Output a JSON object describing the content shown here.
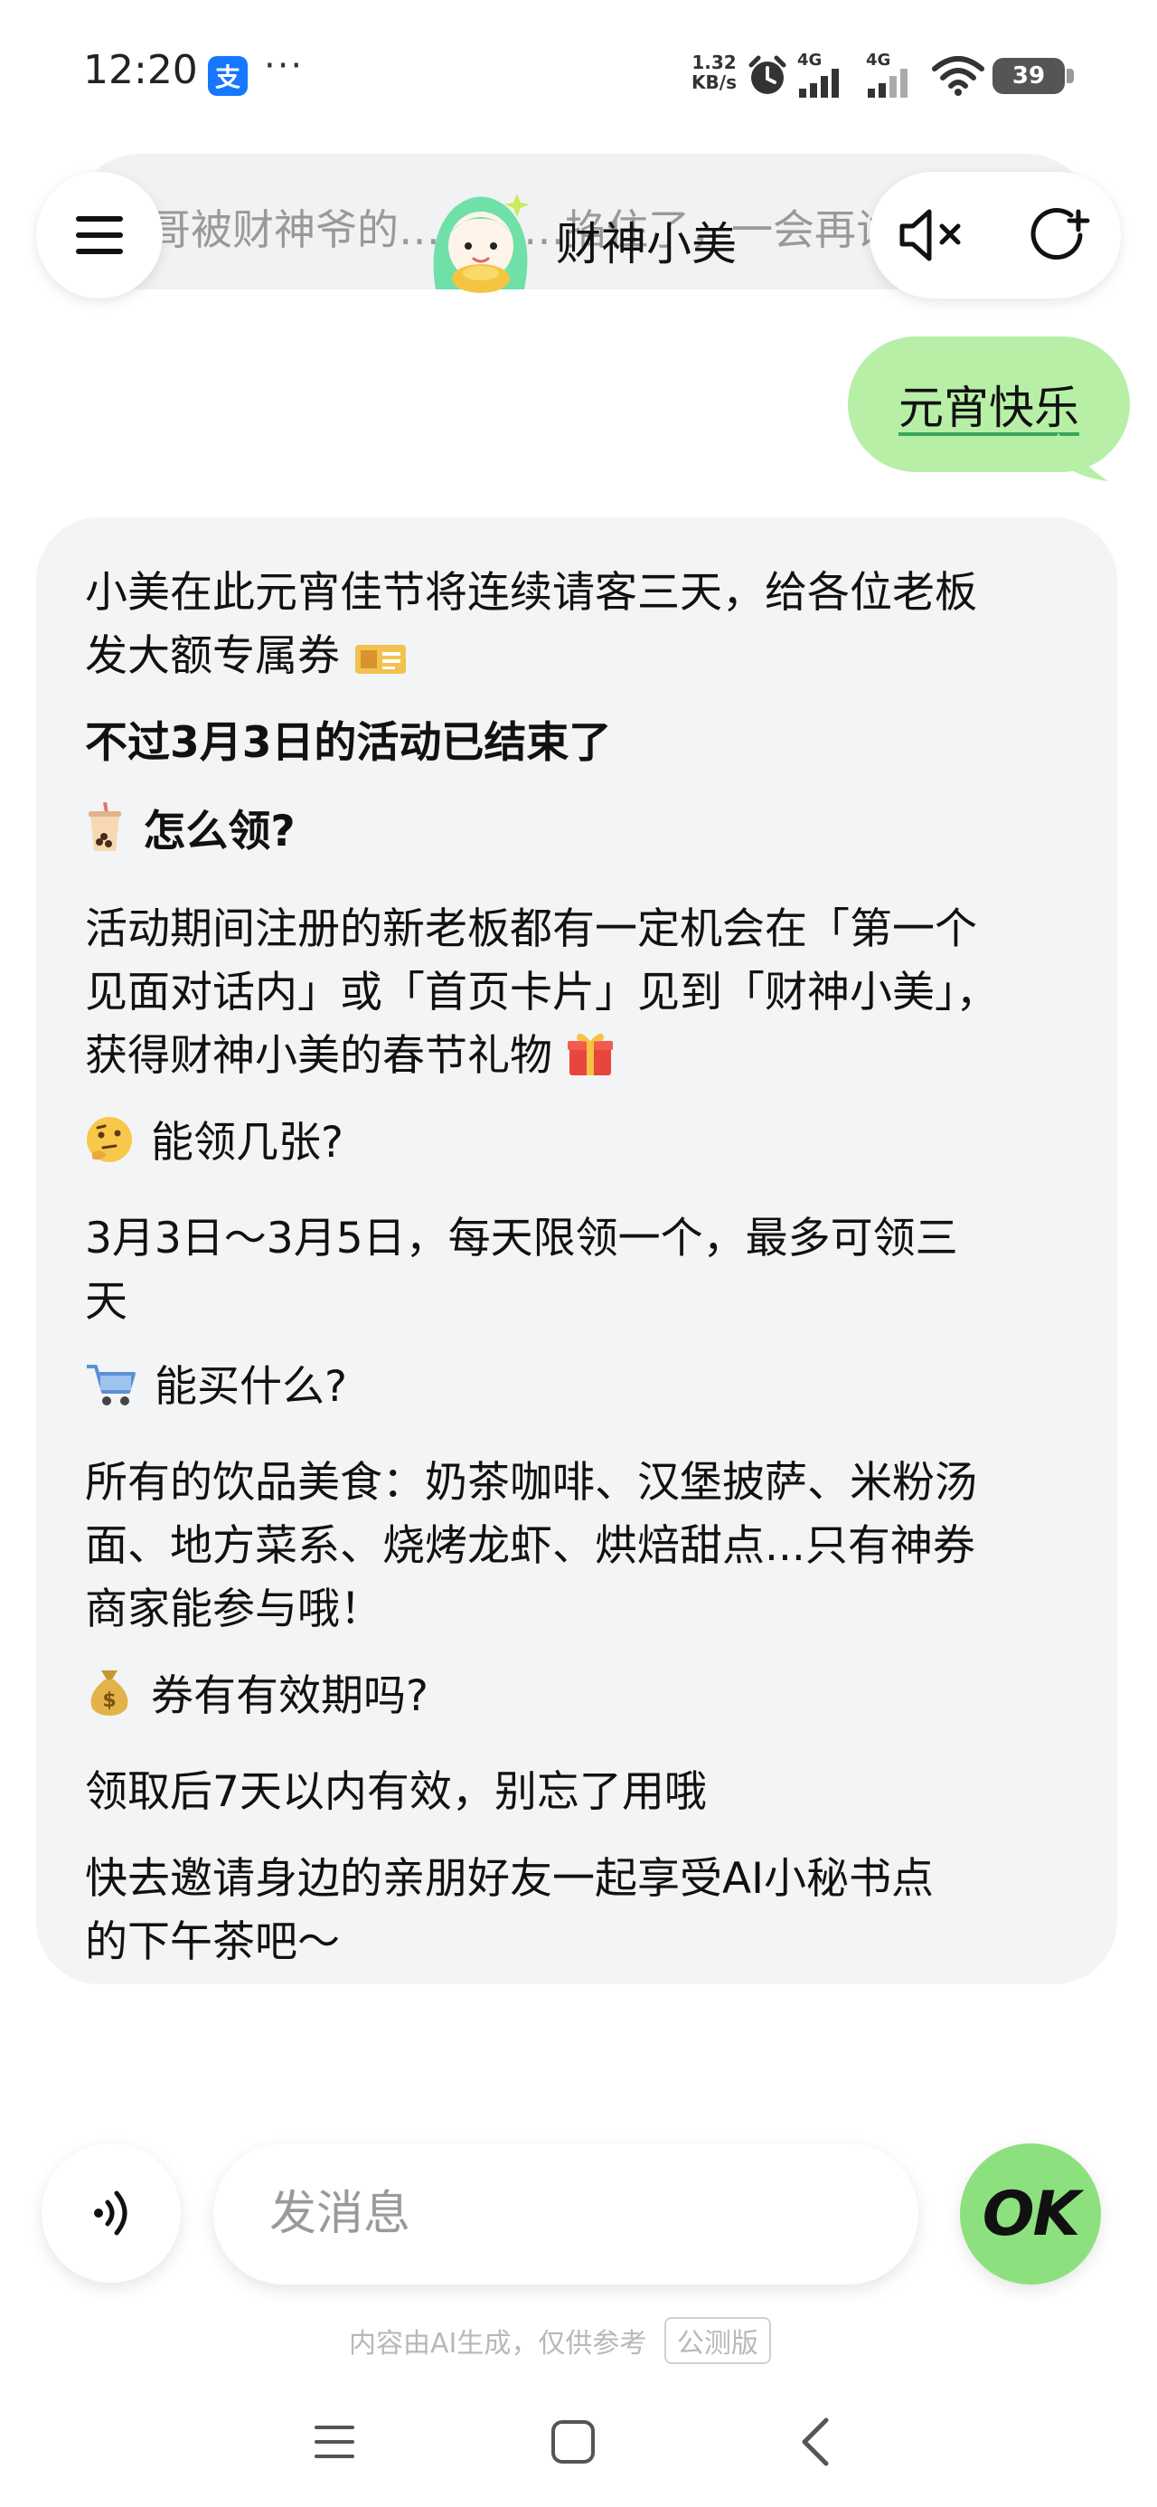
{
  "status_bar": {
    "time": "12:20",
    "alipay_glyph": "支",
    "more": "···",
    "net_speed_value": "1.32",
    "net_speed_unit": "KB/s",
    "sim1_label": "4G",
    "sim2_label": "4G",
    "battery": "39",
    "icons": [
      "alipay-icon",
      "alarm-icon",
      "signal-icon",
      "wifi-icon",
      "battery-icon"
    ]
  },
  "header": {
    "ticker_text": "哥被财神爷的…………掐住了，一会再试",
    "title": "财神小美",
    "icons": [
      "menu-icon",
      "mute-icon",
      "new-chat-icon",
      "avatar"
    ]
  },
  "chat": {
    "user_message": "元宵快乐",
    "assistant_lines": [
      "小美在此元宵佳节将连续请客三天，给各位老板",
      "发大额专属券",
      "不过3月3日的活动已结束了",
      "怎么领?",
      "活动期间注册的新老板都有一定机会在「第一个",
      "见面对话内」或「首页卡片」见到「财神小美」，",
      "获得财神小美的春节礼物",
      "能领几张?",
      "3月3日～3月5日，每天限领一个，最多可领三",
      "天",
      "能买什么?",
      "所有的饮品美食：奶茶咖啡、汉堡披萨、米粉汤",
      "面、地方菜系、烧烤龙虾、烘焙甜点...只有神券",
      "商家能参与哦！",
      "券有有效期吗?",
      "领取后7天以内有效，别忘了用哦",
      "快去邀请身边的亲朋好友一起享受AI小秘书点",
      "的下午茶吧～"
    ],
    "emoji_icons": [
      "coupon-icon",
      "bubble-tea-icon",
      "gift-icon",
      "thinking-face-icon",
      "cart-icon",
      "money-bag-icon"
    ]
  },
  "input": {
    "placeholder": "发消息",
    "send_label": "OK",
    "icons": [
      "voice-icon"
    ]
  },
  "footer": {
    "disclaimer": "内容由AI生成，仅供参考",
    "badge": "公测版"
  },
  "nav_bar": {
    "icons": [
      "recent-apps-icon",
      "home-icon",
      "back-icon"
    ]
  },
  "colors": {
    "user_bubble": "#b7efa7",
    "assistant_bubble": "#f3f4f5",
    "ok_button": "#8de07e",
    "avatar_hair": "#6fe0a8"
  }
}
